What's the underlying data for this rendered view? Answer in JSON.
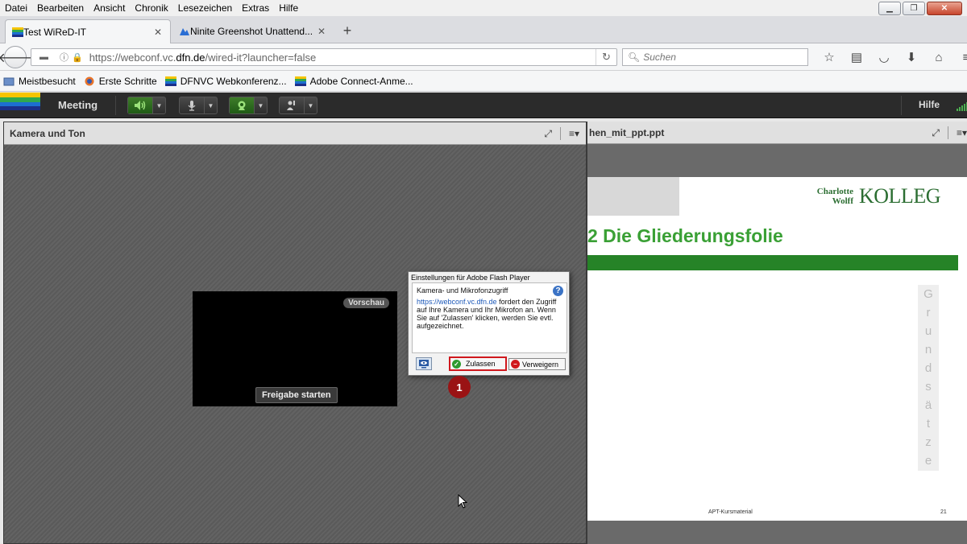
{
  "menubar": {
    "items": [
      "Datei",
      "Bearbeiten",
      "Ansicht",
      "Chronik",
      "Lesezeichen",
      "Extras",
      "Hilfe"
    ]
  },
  "tabs": [
    {
      "label": "Test WiReD-IT",
      "active": true
    },
    {
      "label": "Ninite Greenshot Unattend...",
      "active": false
    }
  ],
  "url": {
    "prefix": "https://webconf.vc.",
    "domain": "dfn.de",
    "suffix": "/wired-it?launcher=false"
  },
  "search": {
    "placeholder": "Suchen"
  },
  "bookmarks": [
    "Meistbesucht",
    "Erste Schritte",
    "DFNVC Webkonferenz...",
    "Adobe Connect-Anme..."
  ],
  "connect": {
    "meeting_label": "Meeting",
    "help_label": "Hilfe"
  },
  "camera_pod": {
    "title": "Kamera und Ton",
    "preview_badge": "Vorschau",
    "share_button": "Freigabe starten"
  },
  "flash_dialog": {
    "title": "Einstellungen für Adobe Flash Player",
    "heading": "Kamera- und Mikrofonzugriff",
    "link": "https://webconf.vc.dfn.de",
    "message": " fordert den Zugriff auf Ihre Kamera und Ihr Mikrofon an. Wenn Sie auf 'Zulassen' klicken, werden Sie evtl. aufgezeichnet.",
    "allow": "Zulassen",
    "deny": "Verweigern"
  },
  "marker": "1",
  "share_pod": {
    "title": "hen_mit_ppt.ppt",
    "logo_line1": "Charlotte",
    "logo_line2": "Wolff",
    "logo_brand": "KOLLEG",
    "slide_title": "2   Die Gliederungsfolie",
    "vertical_letters": [
      "G",
      "r",
      "u",
      "n",
      "d",
      "s",
      "ä",
      "t",
      "z",
      "e"
    ],
    "footer": "APT-Kursmaterial",
    "page_number": "21"
  },
  "colors": {
    "slide_green": "#268327",
    "title_green": "#3aa035",
    "highlight_red": "#d0181d",
    "marker_red": "#9a1314"
  }
}
